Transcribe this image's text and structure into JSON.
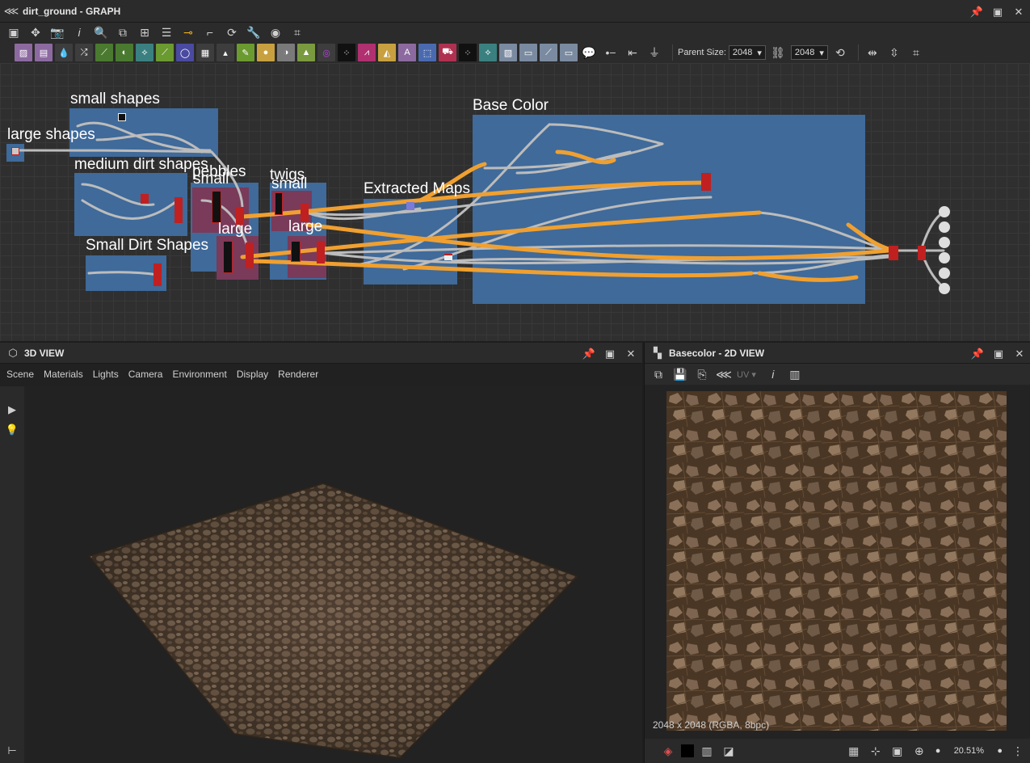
{
  "graph_panel": {
    "title": "dirt_ground - GRAPH",
    "parent_size_label": "Parent Size:",
    "parent_size": "2048",
    "output_size": "2048",
    "frames": [
      {
        "label": "large shapes"
      },
      {
        "label": "small shapes"
      },
      {
        "label": "medium dirt shapes"
      },
      {
        "label": "pebbles"
      },
      {
        "label": "small"
      },
      {
        "label": "twigs"
      },
      {
        "label": "small"
      },
      {
        "label": "large"
      },
      {
        "label": "large"
      },
      {
        "label": "Small Dirt Shapes"
      },
      {
        "label": "Extracted Maps"
      },
      {
        "label": "Base Color"
      }
    ]
  },
  "view3d": {
    "title": "3D VIEW",
    "menus": [
      "Scene",
      "Materials",
      "Lights",
      "Camera",
      "Environment",
      "Display",
      "Renderer"
    ]
  },
  "view2d": {
    "title": "Basecolor - 2D VIEW",
    "uv_label": "UV",
    "image_info": "2048 x 2048 (RGBA, 8bpc)",
    "zoom": "20.51%"
  },
  "colors": {
    "frame_blue": "#3f6a9a",
    "frame_red": "#7a3a5a",
    "wire_orange": "#f0a030",
    "wire_gray": "#bcbcbc"
  }
}
